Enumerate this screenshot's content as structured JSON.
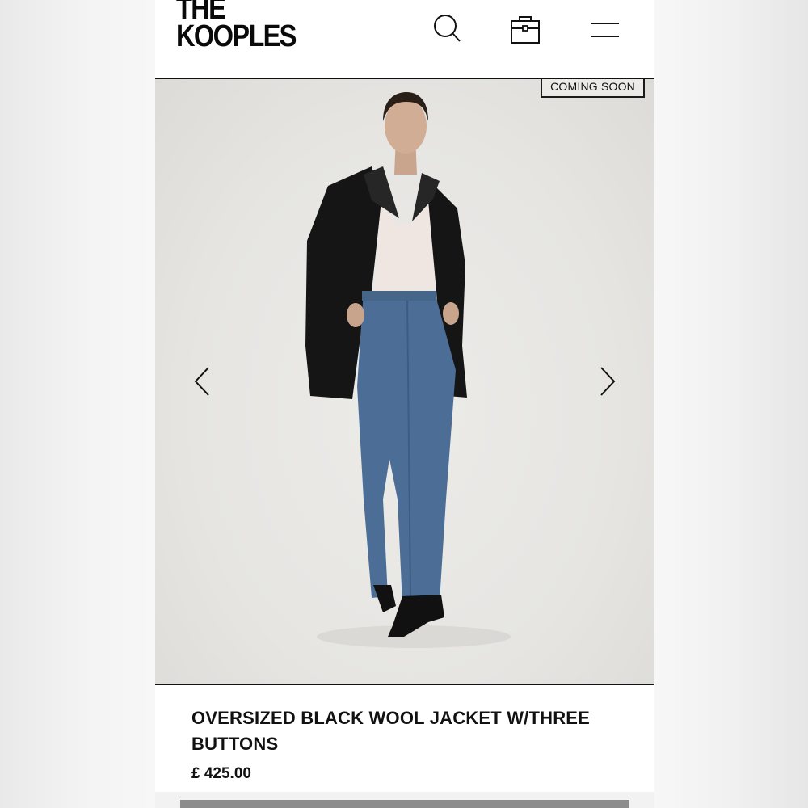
{
  "brand": {
    "logo_line1": "THE",
    "logo_line2": "KOOPLES"
  },
  "header": {
    "icons": [
      "search-icon",
      "shopping-bag-icon",
      "hamburger-menu-icon"
    ]
  },
  "gallery": {
    "badge": "COMING SOON",
    "prev_icon": "chevron-left-icon",
    "next_icon": "chevron-right-icon"
  },
  "product": {
    "title": "OVERSIZED BLACK WOOL JACKET W/THREE BUTTONS",
    "price": "£ 425.00"
  },
  "colors": {
    "text": "#111111",
    "background": "#ffffff",
    "photo_background": "#e6e5e2"
  }
}
